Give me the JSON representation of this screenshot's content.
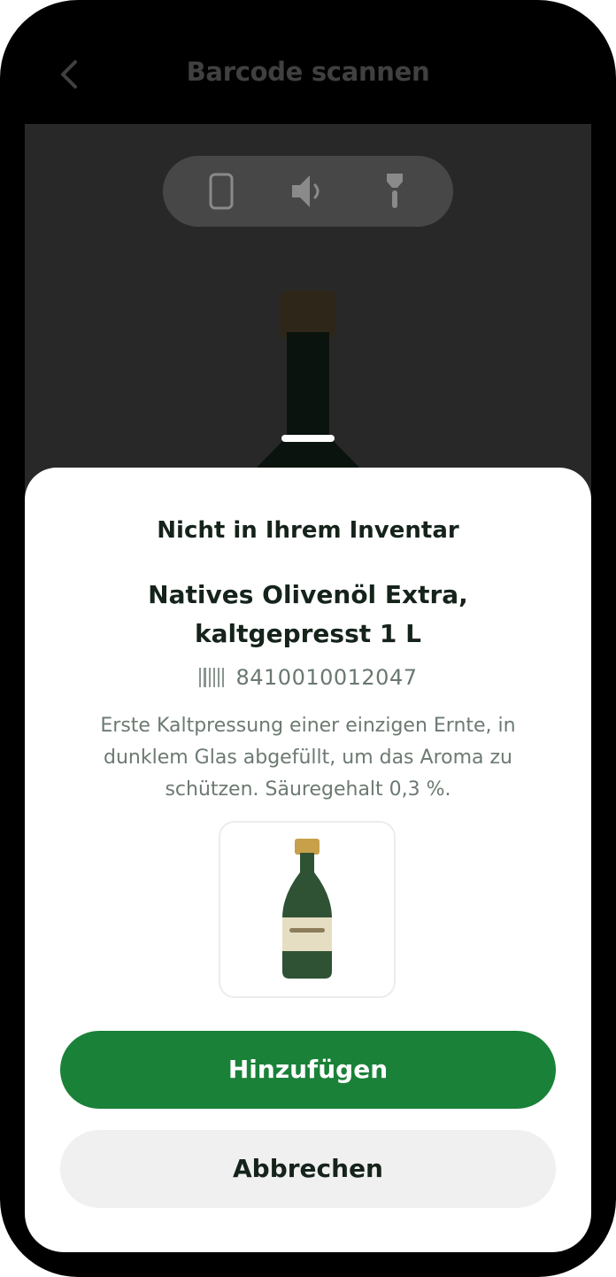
{
  "header": {
    "title": "Barcode scannen",
    "back_icon": "chevron-left-icon"
  },
  "scanner": {
    "controls": [
      {
        "icon": "phone-outline-icon"
      },
      {
        "icon": "speaker-icon"
      },
      {
        "icon": "flashlight-icon"
      }
    ]
  },
  "sheet": {
    "status": "Nicht in Ihrem Inventar",
    "product_name": "Natives Olivenöl Extra, kaltgepresst 1 L",
    "barcode_icon": "barcode-icon",
    "barcode": "8410010012047",
    "description": "Erste Kaltpressung einer einzigen Ernte, in dunklem Glas abgefüllt, um das Aroma zu schützen. Säuregehalt 0,3 %.",
    "product_image_icon": "olive-oil-bottle-icon",
    "primary_label": "Hinzufügen",
    "secondary_label": "Abbrechen"
  },
  "colors": {
    "primary": "#1a8139",
    "secondary_bg": "#f0f0f0",
    "camera_bg": "#282828",
    "frame": "#000000",
    "text_dark": "#15231b",
    "text_muted": "#6c7a71"
  }
}
